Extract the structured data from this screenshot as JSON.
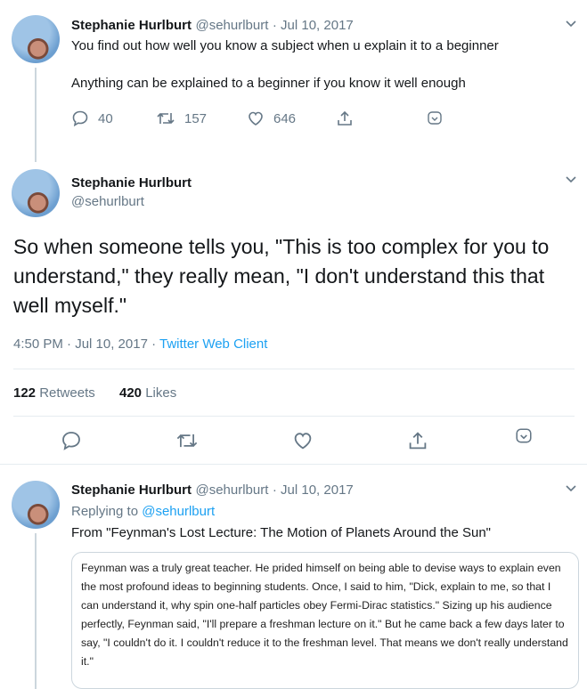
{
  "tweet1": {
    "name": "Stephanie Hurlburt",
    "handle": "@sehurlburt",
    "date": "· Jul 10, 2017",
    "line1": "You find out how well you know a subject when u explain it to a beginner",
    "line2": "Anything can be explained to a beginner if you know it well enough",
    "replies": "40",
    "retweets": "157",
    "likes": "646"
  },
  "tweet2": {
    "name": "Stephanie Hurlburt",
    "handle": "@sehurlburt",
    "text": "So when someone tells you, \"This is too complex for you to understand,\" they really mean, \"I don't understand this that well myself.\"",
    "time": "4:50 PM · Jul 10, 2017 · ",
    "client": "Twitter Web Client",
    "retweet_count": "122",
    "retweet_label": "Retweets",
    "like_count": "420",
    "like_label": "Likes"
  },
  "tweet3": {
    "name": "Stephanie Hurlburt",
    "handle": "@sehurlburt",
    "date": "· Jul 10, 2017",
    "replying_label": "Replying to",
    "replying_handle": "@sehurlburt",
    "text": "From \"Feynman's Lost Lecture: The Motion of Planets Around the Sun\"",
    "quote": "Feynman was a truly great teacher. He prided himself on being able to devise ways to explain even the most profound ideas to beginning students. Once, I said to him, \"Dick, explain to me, so that I can understand it, why spin one-half particles obey Fermi-Dirac statistics.\" Sizing up his audience perfectly, Feynman said, \"I'll prepare a freshman lecture on it.\" But he came back a few days later to say, \"I couldn't do it. I couldn't reduce it to the freshman level. That means we don't really understand it.\""
  },
  "icons": [
    "chevron-down-icon",
    "reply-icon",
    "retweet-icon",
    "like-icon",
    "share-icon",
    "bookmark-icon"
  ],
  "colors": {
    "link": "#1da1f2",
    "muted": "#657786",
    "text": "#14171a",
    "divider": "#e6ecf0"
  }
}
